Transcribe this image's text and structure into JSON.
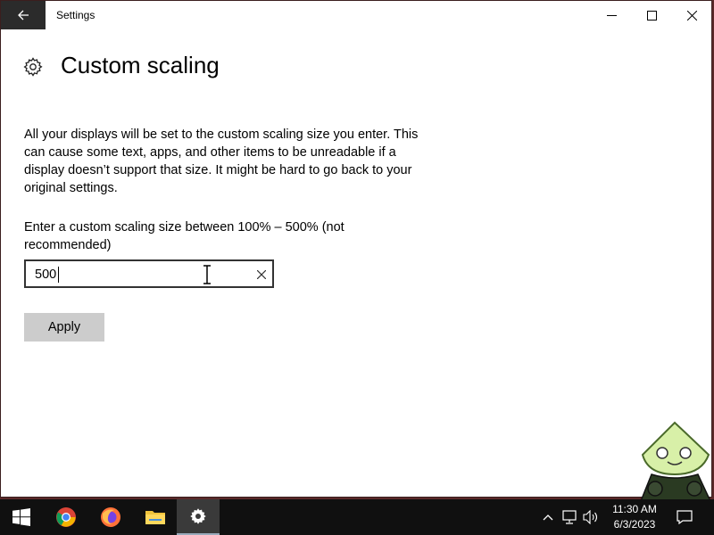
{
  "window": {
    "app_title": "Settings",
    "back_icon": "back-arrow-icon",
    "controls": [
      "minimize-icon",
      "maximize-icon",
      "close-icon"
    ]
  },
  "page": {
    "title": "Custom scaling",
    "title_icon": "gear-icon",
    "warning_text": "All your displays will be set to the custom scaling size you enter. This can cause some text, apps, and other items to be unreadable if a display doesn’t support that size. It might be hard to go back to your original settings.",
    "prompt_text": "Enter a custom scaling size between 100% – 500% (not recommended)"
  },
  "scaling_input": {
    "value": "500",
    "clear_icon": "clear-x-icon"
  },
  "apply_button": {
    "label": "Apply"
  },
  "taskbar": {
    "items": [
      {
        "name": "start-button",
        "icon": "windows-logo-icon"
      },
      {
        "name": "chrome-button",
        "icon": "chrome-icon"
      },
      {
        "name": "firefox-button",
        "icon": "firefox-icon"
      },
      {
        "name": "file-explorer-button",
        "icon": "folder-icon"
      },
      {
        "name": "settings-taskbar-button",
        "icon": "gear-icon",
        "active": true
      }
    ],
    "tray": {
      "icons": [
        "chevron-up-icon",
        "network-icon",
        "volume-icon"
      ],
      "time": "11:30 AM",
      "date": "6/3/2023",
      "notification_icon": "notification-icon"
    }
  },
  "colors": {
    "titlebar_back": "#2b2b2b",
    "apply_bg": "#cccccc",
    "taskbar_bg": "#101010",
    "accent_active": "#3a3a3a"
  }
}
